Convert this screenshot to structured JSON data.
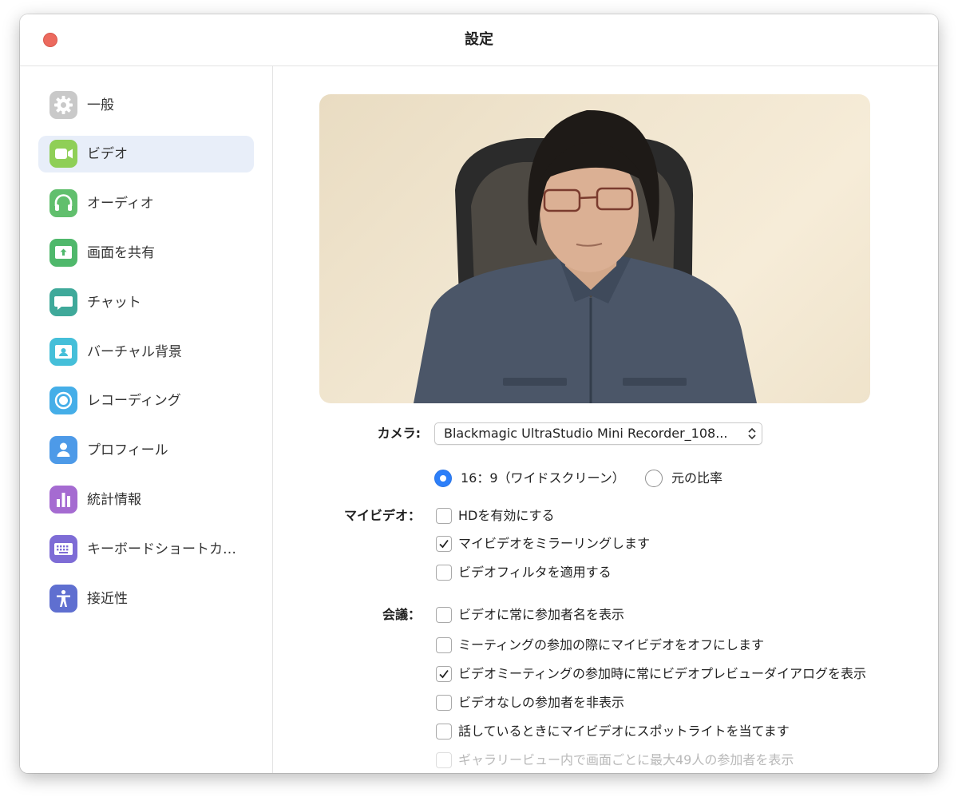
{
  "window": {
    "title": "設定"
  },
  "sidebar": {
    "items": [
      {
        "label": "一般",
        "icon": "gear-icon",
        "color": "#c9c9c9"
      },
      {
        "label": "ビデオ",
        "icon": "video-camera-icon",
        "color": "#8fcf57",
        "active": true
      },
      {
        "label": "オーディオ",
        "icon": "headphones-icon",
        "color": "#61bf6d"
      },
      {
        "label": "画面を共有",
        "icon": "share-screen-icon",
        "color": "#4fb86b"
      },
      {
        "label": "チャット",
        "icon": "chat-bubble-icon",
        "color": "#3fa99a"
      },
      {
        "label": "バーチャル背景",
        "icon": "virtual-background-icon",
        "color": "#45bfd9"
      },
      {
        "label": "レコーディング",
        "icon": "record-icon",
        "color": "#45aee8"
      },
      {
        "label": "プロフィール",
        "icon": "profile-icon",
        "color": "#4d9ae8"
      },
      {
        "label": "統計情報",
        "icon": "statistics-icon",
        "color": "#a56bd1"
      },
      {
        "label": "キーボードショートカ…",
        "icon": "keyboard-icon",
        "color": "#7e6cd6"
      },
      {
        "label": "接近性",
        "icon": "accessibility-icon",
        "color": "#5f6fd0"
      }
    ]
  },
  "video": {
    "camera_label": "カメラ:",
    "camera_value": "Blackmagic UltraStudio Mini Recorder_108...",
    "my_video_label": "マイビデオ：",
    "aspect": {
      "widescreen": "16：9（ワイドスクリーン）",
      "original": "元の比率",
      "selected": "widescreen"
    },
    "my_video_options": [
      {
        "label": "HDを有効にする",
        "checked": false
      },
      {
        "label": "マイビデオをミラーリングします",
        "checked": true
      },
      {
        "label": "ビデオフィルタを適用する",
        "checked": false
      }
    ],
    "meeting_label": "会議：",
    "meeting_options": [
      {
        "label": "ビデオに常に参加者名を表示",
        "checked": false
      },
      {
        "label": "ミーティングの参加の際にマイビデオをオフにします",
        "checked": false
      },
      {
        "label": "ビデオミーティングの参加時に常にビデオプレビューダイアログを表示",
        "checked": true
      },
      {
        "label": "ビデオなしの参加者を非表示",
        "checked": false
      },
      {
        "label": "話しているときにマイビデオにスポットライトを当てます",
        "checked": false
      },
      {
        "label": "ギャラリービュー内で画面ごとに最大49人の参加者を表示",
        "checked": false,
        "disabled": true
      }
    ]
  },
  "colors": {
    "accent": "#2d7ff9",
    "active_nav": "#e8eef9",
    "close_button": "#ec6a5e"
  }
}
